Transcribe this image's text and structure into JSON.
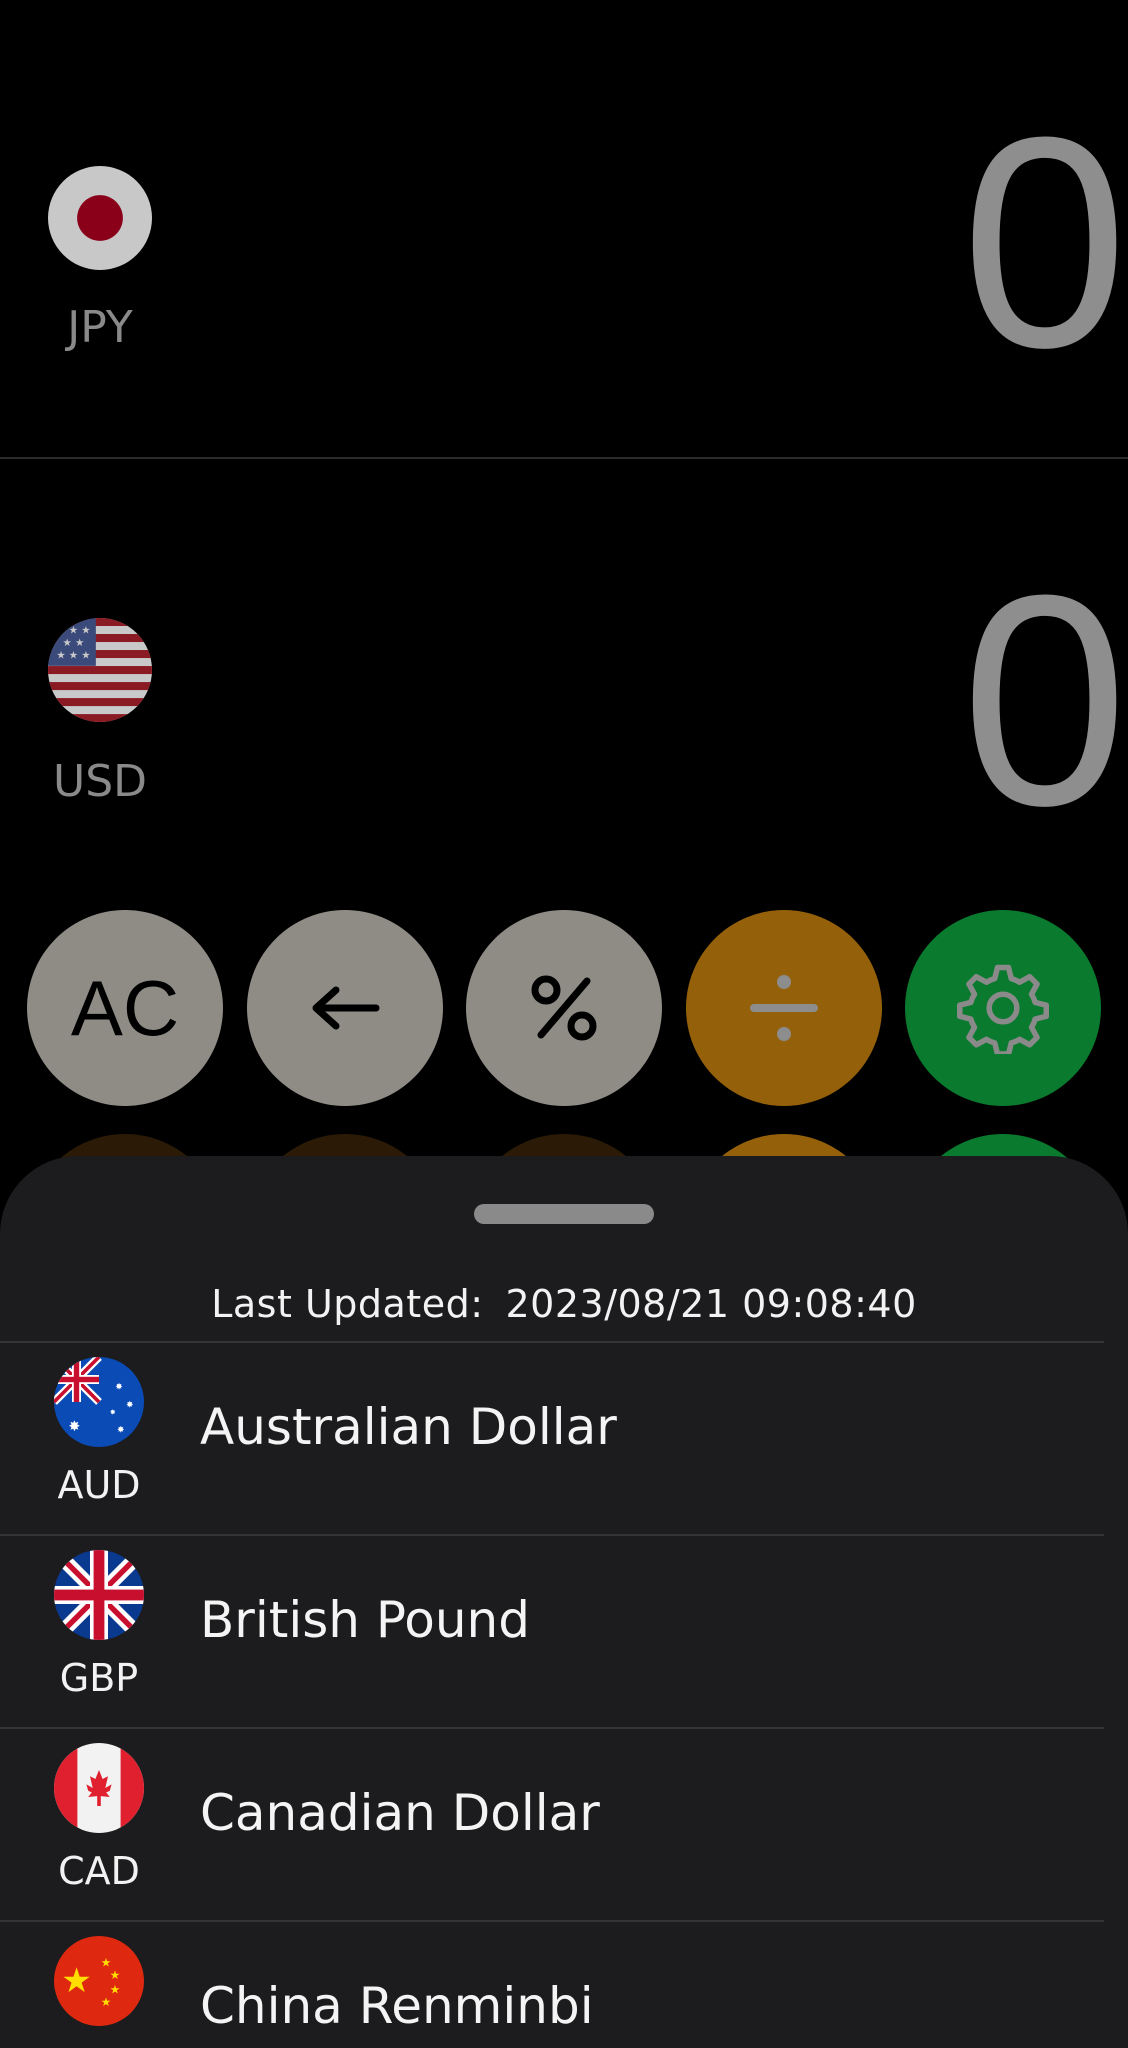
{
  "display": {
    "top": {
      "code": "JPY",
      "amount": "0",
      "flag_icon": "japan-flag-icon"
    },
    "bottom": {
      "code": "USD",
      "amount": "0",
      "flag_icon": "usa-flag-icon"
    }
  },
  "keypad": {
    "row1": [
      {
        "label": "AC",
        "style": "grey"
      },
      {
        "label": "←",
        "style": "grey",
        "icon": "backspace-arrow-icon"
      },
      {
        "label": "%",
        "style": "grey",
        "icon": "percent-icon"
      },
      {
        "label": "÷",
        "style": "orange",
        "icon": "divide-icon"
      },
      {
        "label": "",
        "style": "green",
        "icon": "gear-icon"
      }
    ]
  },
  "sheet": {
    "last_updated_label": "Last Updated:",
    "last_updated_value": "2023/08/21 09:08:40",
    "currencies": [
      {
        "code": "AUD",
        "name": "Australian Dollar",
        "flag_icon": "australia-flag-icon"
      },
      {
        "code": "GBP",
        "name": "British Pound",
        "flag_icon": "uk-flag-icon"
      },
      {
        "code": "CAD",
        "name": "Canadian Dollar",
        "flag_icon": "canada-flag-icon"
      },
      {
        "code": "",
        "name": "China Renminbi",
        "flag_icon": "china-flag-icon"
      }
    ]
  },
  "colors": {
    "orange": "#94600a",
    "green": "#0a7a2e",
    "grey_key": "#8f8c86",
    "sheet_bg": "#1c1c1e"
  }
}
